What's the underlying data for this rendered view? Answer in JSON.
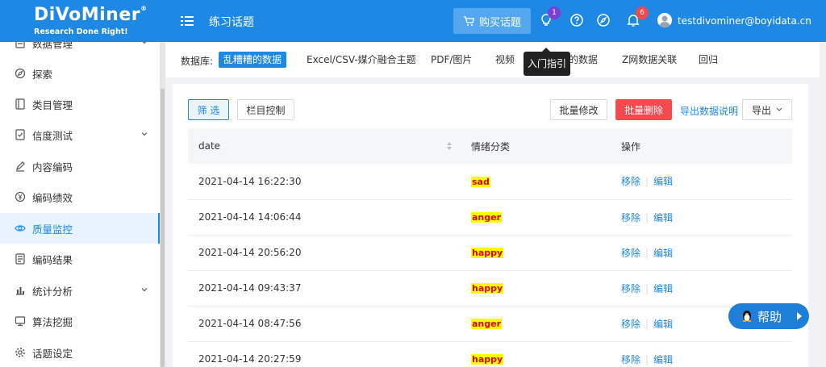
{
  "header": {
    "logo_text": "DiVoMiner",
    "logo_tagline": "Research Done Right!",
    "page_title": "练习话题",
    "buy_button_label": "购买话题",
    "hint_badge": "1",
    "notification_badge": "6",
    "user_email": "testdivominer@boyidata.cn",
    "accent_color": "#1e88e5",
    "badge_colors": {
      "hint": "#7b3fd1",
      "notification": "#f5484f"
    }
  },
  "sidebar": {
    "items": [
      {
        "label": "数据管理",
        "icon": "database-icon",
        "has_chevron": true
      },
      {
        "label": "探索",
        "icon": "explore-icon",
        "has_chevron": false
      },
      {
        "label": "类目管理",
        "icon": "category-icon",
        "has_chevron": false
      },
      {
        "label": "信度测试",
        "icon": "reliability-icon",
        "has_chevron": true
      },
      {
        "label": "内容编码",
        "icon": "edit-icon",
        "has_chevron": false
      },
      {
        "label": "编码绩效",
        "icon": "yen-icon",
        "has_chevron": false
      },
      {
        "label": "质量监控",
        "icon": "eye-icon",
        "has_chevron": false,
        "active": true
      },
      {
        "label": "编码结果",
        "icon": "result-icon",
        "has_chevron": false
      },
      {
        "label": "统计分析",
        "icon": "chart-icon",
        "has_chevron": true
      },
      {
        "label": "算法挖掘",
        "icon": "monitor-icon",
        "has_chevron": false
      },
      {
        "label": "话题设定",
        "icon": "gear-icon",
        "has_chevron": false
      }
    ]
  },
  "database_bar": {
    "label": "数据库:",
    "tabs": [
      "乱糟糟的数据",
      "Excel/CSV-媒介融合主题",
      "PDF/图片",
      "视频",
      "的数据",
      "Z网数据关联",
      "回归"
    ],
    "active_index": 0
  },
  "tooltip": "入门指引",
  "toolbar": {
    "filter_label": "筛 选",
    "columns_label": "栏目控制",
    "batch_edit_label": "批量修改",
    "batch_delete_label": "批量删除",
    "export_help_label": "导出数据说明",
    "export_label": "导出"
  },
  "table": {
    "headers": [
      "date",
      "情绪分类",
      "操作"
    ],
    "actions": {
      "remove": "移除",
      "edit": "编辑"
    },
    "rows": [
      {
        "date": "2021-04-14 16:22:30",
        "emotion": "sad"
      },
      {
        "date": "2021-04-14 14:06:44",
        "emotion": "anger"
      },
      {
        "date": "2021-04-14 20:56:20",
        "emotion": "happy"
      },
      {
        "date": "2021-04-14 09:43:37",
        "emotion": "happy"
      },
      {
        "date": "2021-04-14 08:47:56",
        "emotion": "anger"
      },
      {
        "date": "2021-04-14 20:27:59",
        "emotion": "happy"
      }
    ]
  },
  "help_button_label": "帮助"
}
